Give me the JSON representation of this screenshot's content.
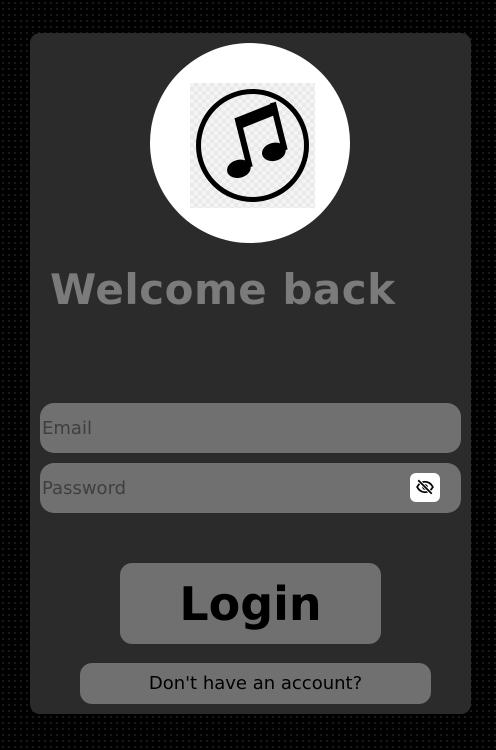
{
  "header": {
    "logo_icon": "music-note-icon",
    "title": "Welcome back"
  },
  "form": {
    "email": {
      "placeholder": "Email",
      "value": ""
    },
    "password": {
      "placeholder": "Password",
      "value": "",
      "toggle_icon": "eye-slash-icon"
    },
    "login_label": "Login",
    "signup_label": "Don't have an account?"
  },
  "colors": {
    "page_background": "#000000",
    "card_background": "#2b2b2b",
    "field_background": "#707070",
    "title_text": "#7b7b7b",
    "button_text": "#000000"
  }
}
